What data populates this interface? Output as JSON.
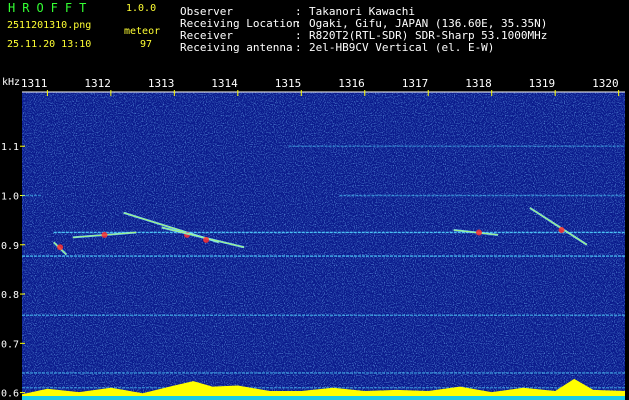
{
  "header": {
    "brand": "HROFFT",
    "version": "1.0.0",
    "filename": "2511201310.png",
    "detection_label": "meteor",
    "timestamp": "25.11.20 13:10",
    "detection_count": "97"
  },
  "meta_sep": ":",
  "meta": [
    {
      "key": "Observer",
      "value": "Takanori Kawachi"
    },
    {
      "key": "Receiving Location",
      "value": "Ogaki, Gifu, JAPAN (136.60E, 35.35N)"
    },
    {
      "key": "Receiver",
      "value": "R820T2(RTL-SDR) SDR-Sharp 53.1000MHz"
    },
    {
      "key": "Receiving antenna",
      "value": "2el-HB9CV Vertical (el. E-W)"
    }
  ],
  "colors": {
    "background": "#0a1a8c",
    "axis_text": "#ffffff",
    "tick": "#ffff00",
    "signal_line": "#4fd2ff",
    "strong_signal": "#ff3030",
    "noise_bar": "#ffff00",
    "noise_floor": "#00c8ff"
  },
  "chart_data": {
    "type": "heatmap",
    "ylabel": "kHz",
    "x_ticks": [
      "1311",
      "1312",
      "1313",
      "1314",
      "1315",
      "1316",
      "1317",
      "1318",
      "1319",
      "1320"
    ],
    "x_range": [
      1310.6,
      1320.1
    ],
    "y_ticks": [
      "1.1",
      "1.0",
      "0.9",
      "0.8",
      "0.7",
      "0.6"
    ],
    "y_range": [
      0.585,
      1.21
    ],
    "carrier_lines": [
      {
        "freq_khz": 1.1,
        "from_min": 1314.8,
        "to_min": 1320.1,
        "intensity": 0.5
      },
      {
        "freq_khz": 1.0,
        "from_min": 1310.6,
        "to_min": 1310.9,
        "intensity": 0.5
      },
      {
        "freq_khz": 1.0,
        "from_min": 1315.6,
        "to_min": 1320.1,
        "intensity": 0.55
      },
      {
        "freq_khz": 0.925,
        "from_min": 1311.1,
        "to_min": 1320.1,
        "intensity": 0.9
      },
      {
        "freq_khz": 0.877,
        "from_min": 1310.6,
        "to_min": 1320.1,
        "intensity": 0.8
      },
      {
        "freq_khz": 0.757,
        "from_min": 1310.6,
        "to_min": 1320.1,
        "intensity": 0.6
      },
      {
        "freq_khz": 0.64,
        "from_min": 1310.6,
        "to_min": 1320.1,
        "intensity": 0.6
      },
      {
        "freq_khz": 0.61,
        "from_min": 1310.6,
        "to_min": 1320.1,
        "intensity": 0.5
      }
    ],
    "meteor_echoes": [
      {
        "start": [
          1312.2,
          0.965
        ],
        "end": [
          1313.7,
          0.905
        ],
        "peak": [
          1313.2,
          0.92
        ]
      },
      {
        "start": [
          1312.8,
          0.935
        ],
        "end": [
          1314.1,
          0.895
        ],
        "peak": [
          1313.5,
          0.91
        ]
      },
      {
        "start": [
          1311.4,
          0.915
        ],
        "end": [
          1312.4,
          0.925
        ],
        "peak": [
          1311.9,
          0.92
        ]
      },
      {
        "start": [
          1317.4,
          0.93
        ],
        "end": [
          1318.1,
          0.92
        ],
        "peak": [
          1317.8,
          0.925
        ]
      },
      {
        "start": [
          1318.6,
          0.975
        ],
        "end": [
          1319.5,
          0.9
        ],
        "peak": [
          1319.1,
          0.93
        ]
      },
      {
        "start": [
          1311.1,
          0.905
        ],
        "end": [
          1311.3,
          0.88
        ],
        "peak": [
          1311.2,
          0.895
        ]
      }
    ],
    "noise_profile": [
      [
        1310.6,
        0.3
      ],
      [
        1311.0,
        0.45
      ],
      [
        1311.5,
        0.4
      ],
      [
        1312.0,
        0.5
      ],
      [
        1312.5,
        0.35
      ],
      [
        1313.0,
        0.6
      ],
      [
        1313.3,
        0.9
      ],
      [
        1313.6,
        0.55
      ],
      [
        1314.0,
        0.7
      ],
      [
        1314.5,
        0.35
      ],
      [
        1315.0,
        0.45
      ],
      [
        1315.5,
        0.5
      ],
      [
        1316.0,
        0.45
      ],
      [
        1316.5,
        0.4
      ],
      [
        1317.0,
        0.45
      ],
      [
        1317.5,
        0.55
      ],
      [
        1318.0,
        0.4
      ],
      [
        1318.5,
        0.5
      ],
      [
        1319.0,
        0.45
      ],
      [
        1319.3,
        0.9
      ],
      [
        1319.6,
        0.5
      ],
      [
        1320.1,
        0.35
      ]
    ],
    "grid": false
  }
}
